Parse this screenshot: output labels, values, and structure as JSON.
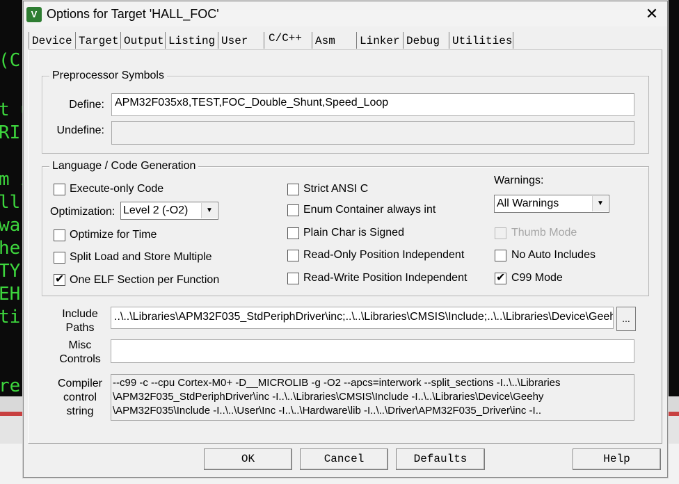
{
  "background": {
    "code_fragments": [
      "(C)",
      "t u",
      "RI",
      "m i",
      "ll",
      "wa",
      "he",
      "TY",
      "EH",
      "ti",
      "re"
    ]
  },
  "window": {
    "title": "Options for Target 'HALL_FOC'",
    "icon": "keil-uvision-icon",
    "close_glyph": "✕"
  },
  "tabs": [
    {
      "label": "Device"
    },
    {
      "label": "Target"
    },
    {
      "label": "Output"
    },
    {
      "label": "Listing"
    },
    {
      "label": "User"
    },
    {
      "label": "C/C++",
      "active": true
    },
    {
      "label": "Asm"
    },
    {
      "label": "Linker"
    },
    {
      "label": "Debug"
    },
    {
      "label": "Utilities"
    }
  ],
  "preprocessor": {
    "title": "Preprocessor Symbols",
    "define_label": "Define:",
    "define_value": "APM32F035x8,TEST,FOC_Double_Shunt,Speed_Loop",
    "undefine_label": "Undefine:",
    "undefine_value": ""
  },
  "language": {
    "title": "Language / Code Generation",
    "execute_only": {
      "label": "Execute-only Code",
      "checked": false
    },
    "optimization_label": "Optimization:",
    "optimization_value": "Level 2 (-O2)",
    "optimize_time": {
      "label": "Optimize for Time",
      "checked": false
    },
    "split_load": {
      "label": "Split Load and Store Multiple",
      "checked": false
    },
    "one_elf": {
      "label": "One ELF Section per Function",
      "checked": true
    },
    "strict_ansi": {
      "label": "Strict ANSI C",
      "checked": false
    },
    "enum_container": {
      "label": "Enum Container always int",
      "checked": false
    },
    "plain_char": {
      "label": "Plain Char is Signed",
      "checked": false
    },
    "ro_position": {
      "label": "Read-Only Position Independent",
      "checked": false
    },
    "rw_position": {
      "label": "Read-Write Position Independent",
      "checked": false
    },
    "warnings_label": "Warnings:",
    "warnings_value": "All Warnings",
    "thumb_mode": {
      "label": "Thumb Mode",
      "checked": false,
      "disabled": true
    },
    "no_auto_includes": {
      "label": "No Auto Includes",
      "checked": false
    },
    "c99_mode": {
      "label": "C99 Mode",
      "checked": true
    },
    "check_glyph": "✔"
  },
  "include_paths": {
    "label_line1": "Include",
    "label_line2": "Paths",
    "value": "..\\..\\Libraries\\APM32F035_StdPeriphDriver\\inc;..\\..\\Libraries\\CMSIS\\Include;..\\..\\Libraries\\Device\\Geehy\\",
    "browse_label": "..."
  },
  "misc_controls": {
    "label_line1": "Misc",
    "label_line2": "Controls",
    "value": ""
  },
  "compiler_string": {
    "label_line1": "Compiler",
    "label_line2": "control",
    "label_line3": "string",
    "lines": [
      "--c99 -c --cpu Cortex-M0+ -D__MICROLIB -g -O2 --apcs=interwork --split_sections -I..\\..\\Libraries",
      "\\APM32F035_StdPeriphDriver\\inc -I..\\..\\Libraries\\CMSIS\\Include -I..\\..\\Libraries\\Device\\Geehy",
      "\\APM32F035\\Include -I..\\..\\User\\Inc -I..\\..\\Hardware\\lib -I..\\..\\Driver\\APM32F035_Driver\\inc -I.."
    ]
  },
  "buttons": {
    "ok": "OK",
    "cancel": "Cancel",
    "defaults": "Defaults",
    "help": "Help"
  }
}
